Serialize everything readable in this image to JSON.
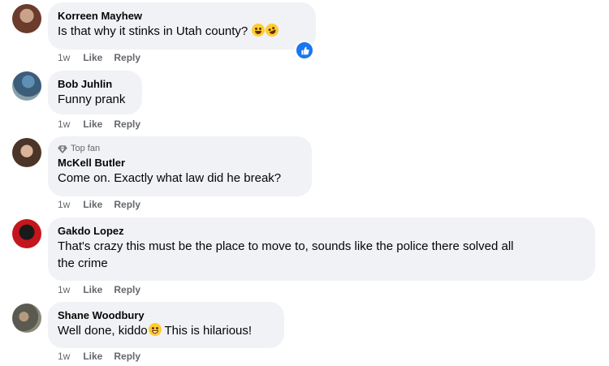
{
  "comments": [
    {
      "name": "Korreen Mayhew",
      "text": "Is that why it stinks in Utah county?",
      "time": "1w",
      "like": "Like",
      "reply": "Reply",
      "emojis": [
        "laughing-face-emoji",
        "rolling-laughing-emoji"
      ],
      "reaction": "like-reaction"
    },
    {
      "name": "Bob Juhlin",
      "text": "Funny prank",
      "time": "1w",
      "like": "Like",
      "reply": "Reply"
    },
    {
      "badge": "Top fan",
      "name": "McKell Butler",
      "text": "Come on. Exactly what law did he break?",
      "time": "1w",
      "like": "Like",
      "reply": "Reply"
    },
    {
      "name": "Gakdo Lopez",
      "text_line1": "That's crazy this must be the place to move to, sounds like the police there solved all",
      "text_line2": "the crime",
      "time": "1w",
      "like": "Like",
      "reply": "Reply"
    },
    {
      "name": "Shane Woodbury",
      "text_before": "Well done, kiddo",
      "text_after": " This is hilarious!",
      "time": "1w",
      "like": "Like",
      "reply": "Reply",
      "emojis": [
        "grinning-face-emoji"
      ]
    }
  ],
  "colors": {
    "bubble": "#f0f2f5",
    "meta": "#65676b",
    "like_blue": "#1877f2"
  }
}
